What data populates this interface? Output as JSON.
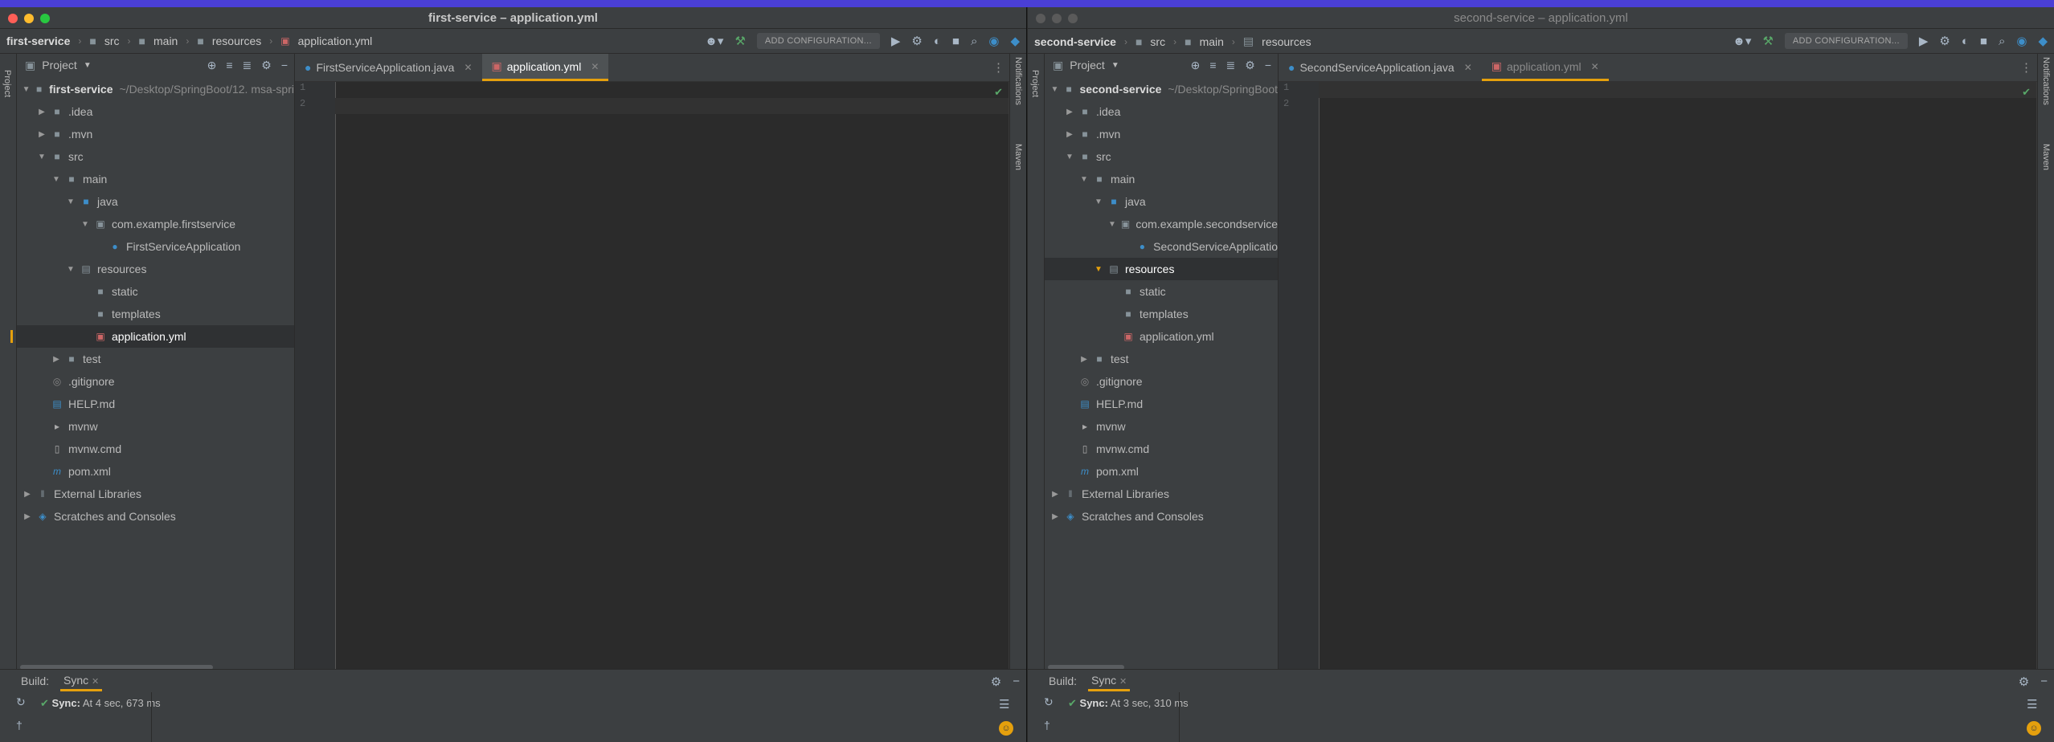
{
  "colors": {
    "accent": "#e5a00d",
    "menubar": "#4a3fd6",
    "close": "#ff5f57",
    "minimize": "#febc2e",
    "zoom": "#28c840",
    "inactive": "#5a5a5a"
  },
  "left": {
    "title": "first-service – application.yml",
    "crumbs": [
      "first-service",
      "src",
      "main",
      "resources",
      "application.yml"
    ],
    "add_config": "ADD CONFIGURATION...",
    "project_label": "Project",
    "stripe_left": "Project",
    "stripe_right_1": "Notifications",
    "stripe_right_2": "Maven",
    "tree": [
      {
        "label": "first-service",
        "extra": "~/Desktop/SpringBoot/12. msa-spri",
        "bold": true
      },
      {
        "label": ".idea"
      },
      {
        "label": ".mvn"
      },
      {
        "label": "src"
      },
      {
        "label": "main"
      },
      {
        "label": "java"
      },
      {
        "label": "com.example.firstservice"
      },
      {
        "label": "FirstServiceApplication"
      },
      {
        "label": "resources"
      },
      {
        "label": "static"
      },
      {
        "label": "templates"
      },
      {
        "label": "application.yml"
      },
      {
        "label": "test"
      },
      {
        "label": ".gitignore"
      },
      {
        "label": "HELP.md"
      },
      {
        "label": "mvnw"
      },
      {
        "label": "mvnw.cmd"
      },
      {
        "label": "pom.xml"
      },
      {
        "label": "External Libraries"
      },
      {
        "label": "Scratches and Consoles"
      }
    ],
    "tabs": [
      "FirstServiceApplication.java",
      "application.yml"
    ],
    "lines": [
      "1",
      "2"
    ],
    "build_label": "Build:",
    "sync_tab": "Sync",
    "sync_title": "Sync:",
    "sync_detail": "At 4 sec, 673 ms"
  },
  "right": {
    "title": "second-service – application.yml",
    "crumbs": [
      "second-service",
      "src",
      "main",
      "resources"
    ],
    "add_config": "ADD CONFIGURATION...",
    "project_label": "Project",
    "stripe_left": "Project",
    "stripe_right_1": "Notifications",
    "stripe_right_2": "Maven",
    "tree": [
      {
        "label": "second-service",
        "extra": "~/Desktop/SpringBoot",
        "bold": true
      },
      {
        "label": ".idea"
      },
      {
        "label": ".mvn"
      },
      {
        "label": "src"
      },
      {
        "label": "main"
      },
      {
        "label": "java"
      },
      {
        "label": "com.example.secondservice"
      },
      {
        "label": "SecondServiceApplicatio"
      },
      {
        "label": "resources"
      },
      {
        "label": "static"
      },
      {
        "label": "templates"
      },
      {
        "label": "application.yml"
      },
      {
        "label": "test"
      },
      {
        "label": ".gitignore"
      },
      {
        "label": "HELP.md"
      },
      {
        "label": "mvnw"
      },
      {
        "label": "mvnw.cmd"
      },
      {
        "label": "pom.xml"
      },
      {
        "label": "External Libraries"
      },
      {
        "label": "Scratches and Consoles"
      }
    ],
    "tabs": [
      "SecondServiceApplication.java",
      "application.yml"
    ],
    "lines": [
      "1",
      "2"
    ],
    "build_label": "Build:",
    "sync_tab": "Sync",
    "sync_title": "Sync:",
    "sync_detail": "At 3 sec, 310 ms"
  }
}
